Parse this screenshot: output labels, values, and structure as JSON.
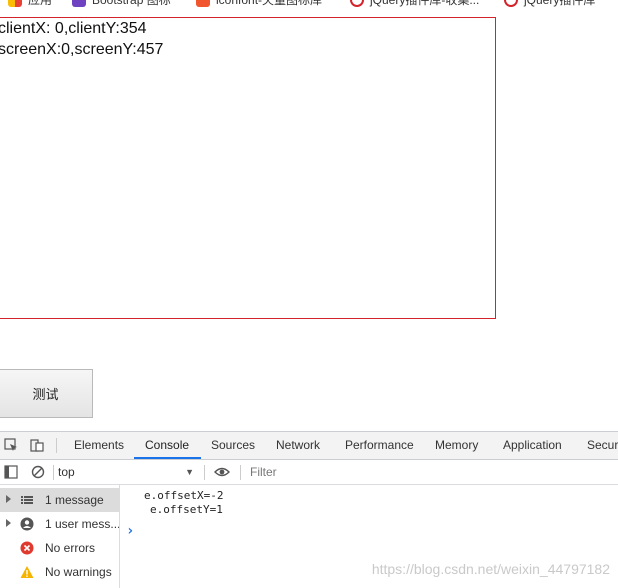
{
  "bookmarks": [
    {
      "label": "应用",
      "color": "#3c7be8"
    },
    {
      "label": "Bootstrap 图标",
      "color": "#6f42c1"
    },
    {
      "label": "iconfont-矢量图标库",
      "color": "#f0552e"
    },
    {
      "label": "jQuery插件库-收集...",
      "color": "#d4232b"
    },
    {
      "label": "jQuery插件库",
      "color": "#d4232b"
    }
  ],
  "page": {
    "client_line": "clientX: 0,clientY:354",
    "screen_line": "screenX:0,screenY:457",
    "button_label": "测试",
    "box_border_color": "#d4232b"
  },
  "devtools": {
    "tabs": [
      "Elements",
      "Console",
      "Sources",
      "Network",
      "Performance",
      "Memory",
      "Application",
      "Securi"
    ],
    "active_tab": "Console",
    "context": "top",
    "filter_placeholder": "Filter",
    "sidebar": [
      {
        "label": "1 message",
        "icon": "list-icon"
      },
      {
        "label": "1 user mess...",
        "icon": "user-icon"
      },
      {
        "label": "No errors",
        "icon": "error-icon"
      },
      {
        "label": "No warnings",
        "icon": "warning-icon"
      }
    ],
    "console_lines": [
      "e.offsetX=-2",
      "e.offsetY=1"
    ],
    "prompt": "›"
  },
  "watermark": "https://blog.csdn.net/weixin_44797182"
}
